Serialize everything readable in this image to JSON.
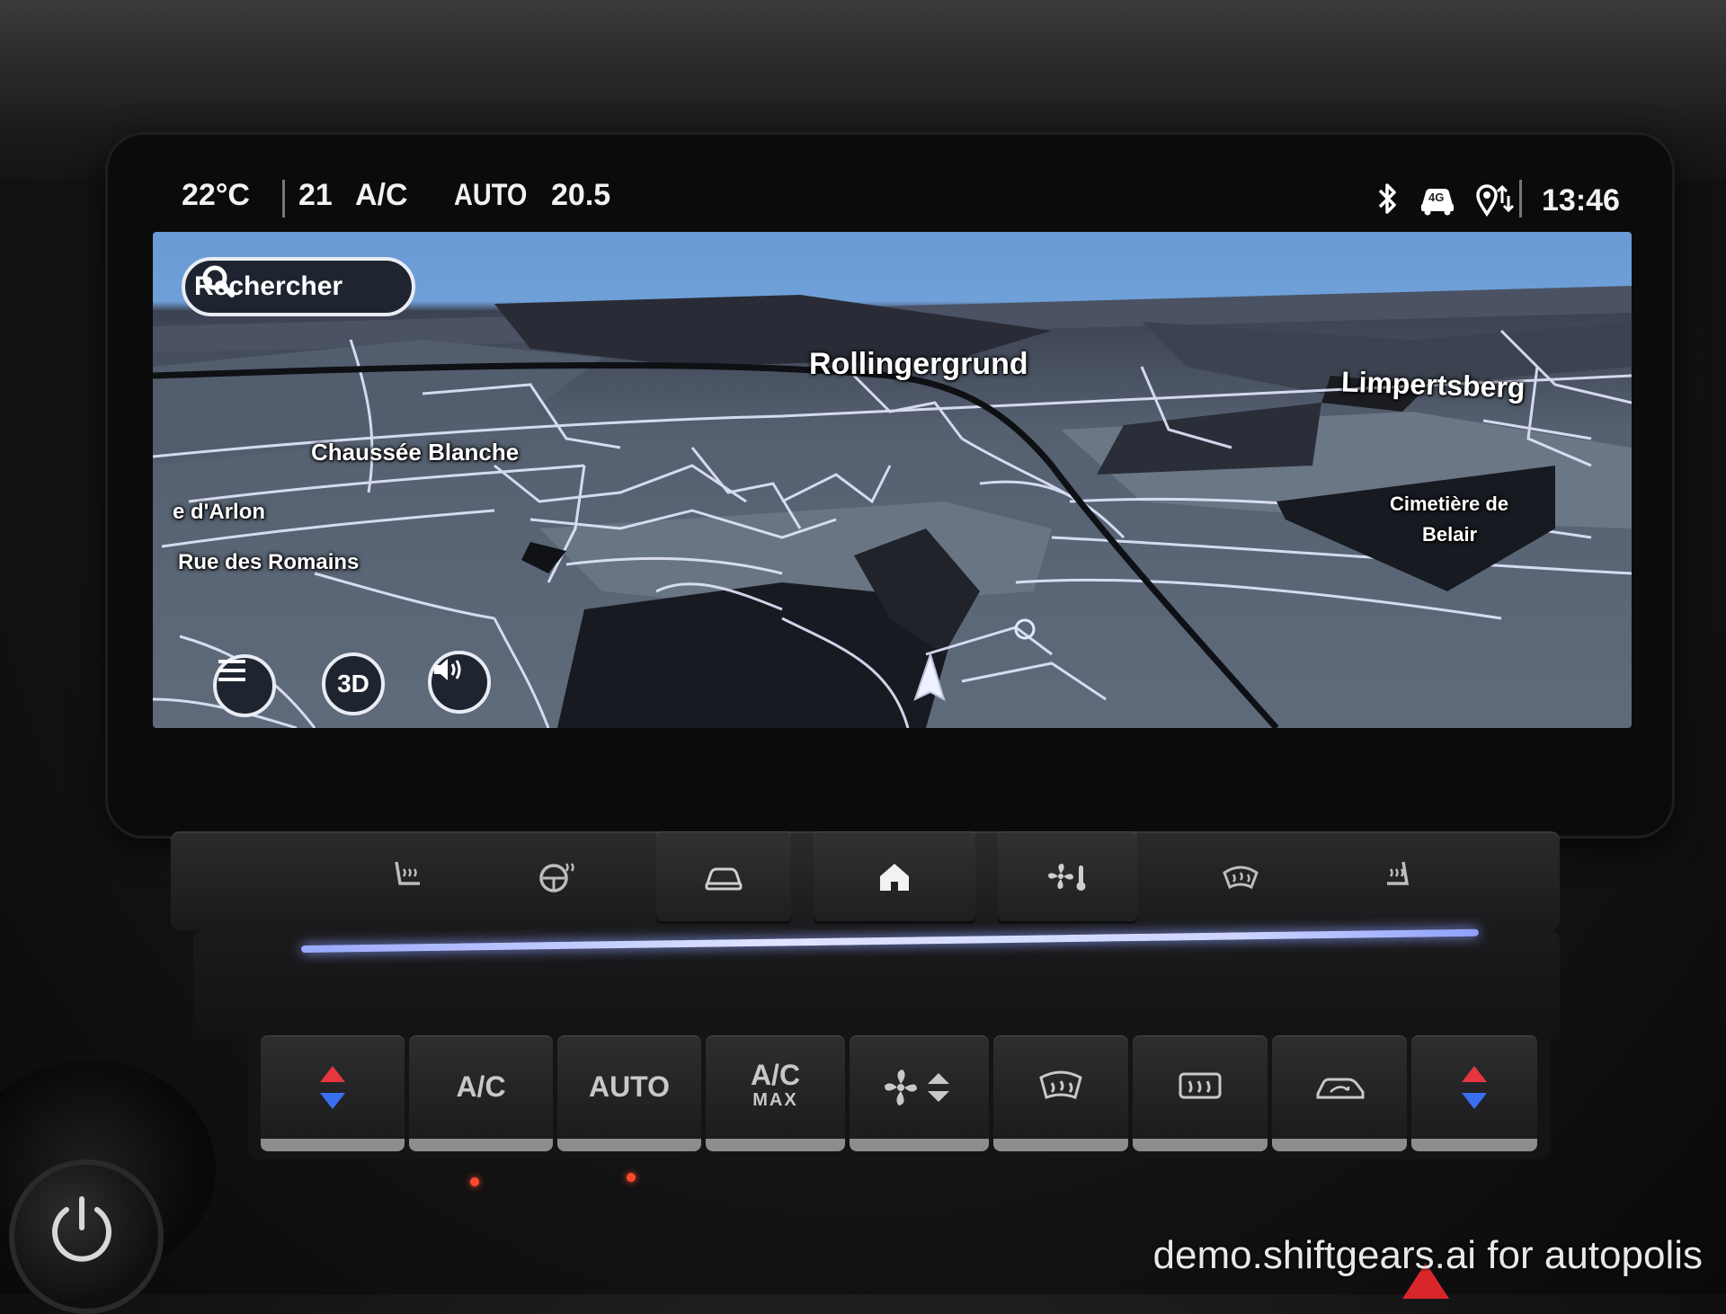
{
  "status_bar": {
    "outside_temp": "22°C",
    "driver_temp": "21",
    "ac_label": "A/C",
    "auto_label": "AUTO",
    "passenger_temp": "20.5",
    "network_badge": "4G",
    "clock": "13:46",
    "icons": [
      "bluetooth-icon",
      "connected-car-icon",
      "location-sharing-icon"
    ]
  },
  "map": {
    "search_label": "Rechercher",
    "labels": {
      "rollingergrund": "Rollingergrund",
      "limpertsberg": "Limpertsberg",
      "chaussee_blanche": "Chaussée Blanche",
      "rue_darlon": "e d'Arlon",
      "rue_des_romains": "Rue des Romains",
      "cimetiere_line1": "Cimetière de",
      "cimetiere_line2": "Belair"
    },
    "view_mode_label": "3D",
    "colors": {
      "sky": "#6fa0d8",
      "route": "#0f1014",
      "roads": "#e8ecff"
    }
  },
  "console_upper": {
    "buttons": [
      "heated-seat-icon",
      "heated-steering-icon",
      "car-settings-icon",
      "home-icon",
      "climate-settings-icon",
      "front-defrost-icon",
      "ventilated-seat-icon"
    ]
  },
  "console_lower": {
    "ac_label": "A/C",
    "auto_label": "AUTO",
    "ac_max_line1": "A/C",
    "ac_max_line2": "MAX"
  },
  "watermark": "demo.shiftgears.ai for autopolis"
}
